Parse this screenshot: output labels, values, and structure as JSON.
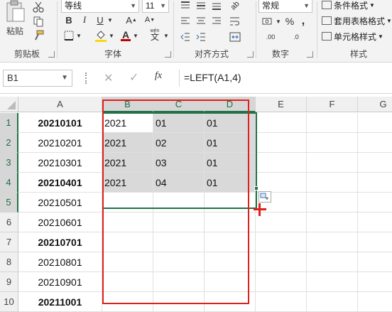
{
  "ribbon": {
    "clipboard": {
      "paste_label": "粘贴",
      "group_label": "剪贴板"
    },
    "font": {
      "font_name": "等线",
      "font_size": "11",
      "group_label": "字体",
      "bold": "B",
      "italic": "I",
      "underline": "U",
      "font_color_letter": "A",
      "wen_label": "wén",
      "wen_char": "文",
      "font_color": "#c00000",
      "fill_color": "#ffd700"
    },
    "alignment": {
      "group_label": "对齐方式"
    },
    "number": {
      "format": "常规",
      "percent": "%",
      "comma": ",",
      "inc_dec": ".00",
      "dec_dec": ".0",
      "group_label": "数字"
    },
    "styles": {
      "conditional_format": "条件格式",
      "table_format": "套用表格格式",
      "cell_styles": "单元格样式",
      "group_label": "样式"
    }
  },
  "formula_bar": {
    "name_box": "B1",
    "fx": "fx",
    "formula": "=LEFT(A1,4)"
  },
  "sheet": {
    "columns": [
      "A",
      "B",
      "C",
      "D",
      "E",
      "F",
      "G"
    ],
    "rows": [
      "1",
      "2",
      "3",
      "4",
      "5",
      "6",
      "7",
      "8",
      "9",
      "10"
    ],
    "col_a": [
      "20210101",
      "20210201",
      "20210301",
      "20210401",
      "20210501",
      "20210601",
      "20210701",
      "20210801",
      "20210901",
      "20211001"
    ],
    "col_b": [
      "2021",
      "2021",
      "2021",
      "2021",
      "",
      "",
      "",
      "",
      "",
      ""
    ],
    "col_c": [
      "01",
      "02",
      "03",
      "04",
      "",
      "",
      "",
      "",
      "",
      ""
    ],
    "col_d": [
      "01",
      "01",
      "01",
      "01",
      "",
      "",
      "",
      "",
      "",
      ""
    ],
    "bold_rows": [
      1,
      4,
      7,
      10
    ],
    "selection_color": "#217346",
    "annotation_color": "#e0201c"
  }
}
